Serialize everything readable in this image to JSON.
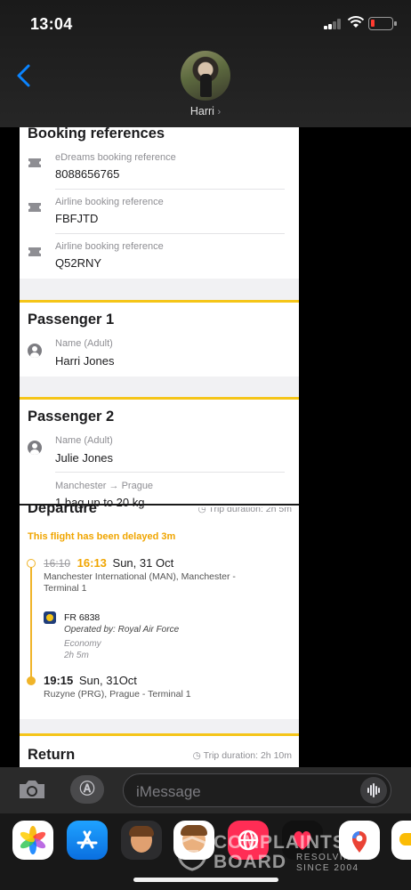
{
  "status": {
    "time": "13:04"
  },
  "header": {
    "contact_name": "Harri",
    "chevron": "›"
  },
  "shot": {
    "booking": {
      "title": "Booking references",
      "items": [
        {
          "label": "eDreams booking reference",
          "value": "8088656765",
          "icon": "ticket-icon"
        },
        {
          "label": "Airline booking reference",
          "value": "FBFJTD",
          "icon": "ticket-icon"
        },
        {
          "label": "Airline booking reference",
          "value": "Q52RNY",
          "icon": "ticket-icon"
        }
      ]
    },
    "passenger1": {
      "title": "Passenger 1",
      "label": "Name (Adult)",
      "value": "Harri Jones"
    },
    "passenger2": {
      "title": "Passenger 2",
      "label": "Name (Adult)",
      "value": "Julie Jones",
      "route": "Manchester → Prague",
      "baggage": "1 bag up to 20 kg"
    },
    "departure": {
      "title": "Departure",
      "trip_duration": "Trip duration: 2h 5m",
      "delay_notice": "This flight has been delayed 3m",
      "old_time": "16:10",
      "new_time": "16:13",
      "date": "Sun, 31 Oct",
      "origin": "Manchester International (MAN), Manchester -",
      "origin_terminal": "Terminal 1",
      "flight_no": "FR 6838",
      "operated_by": "Operated by: Royal Air Force",
      "cabin": "Economy",
      "duration": "2h 5m",
      "arr_time": "19:15",
      "arr_date": "Sun, 31Oct",
      "destination": "Ruzyne (PRG), Prague - Terminal 1"
    },
    "return": {
      "title": "Return",
      "trip_duration": "Trip duration: 2h 10m"
    }
  },
  "input": {
    "placeholder": "iMessage"
  },
  "watermark": {
    "line1": "COMPLAINTS",
    "line2": "BOARD",
    "tag1": "RESOLVING",
    "tag2": "SINCE 2004"
  },
  "colors": {
    "accent_yellow": "#f5c518",
    "delay_orange": "#f0a500",
    "ios_blue": "#0a84ff"
  }
}
